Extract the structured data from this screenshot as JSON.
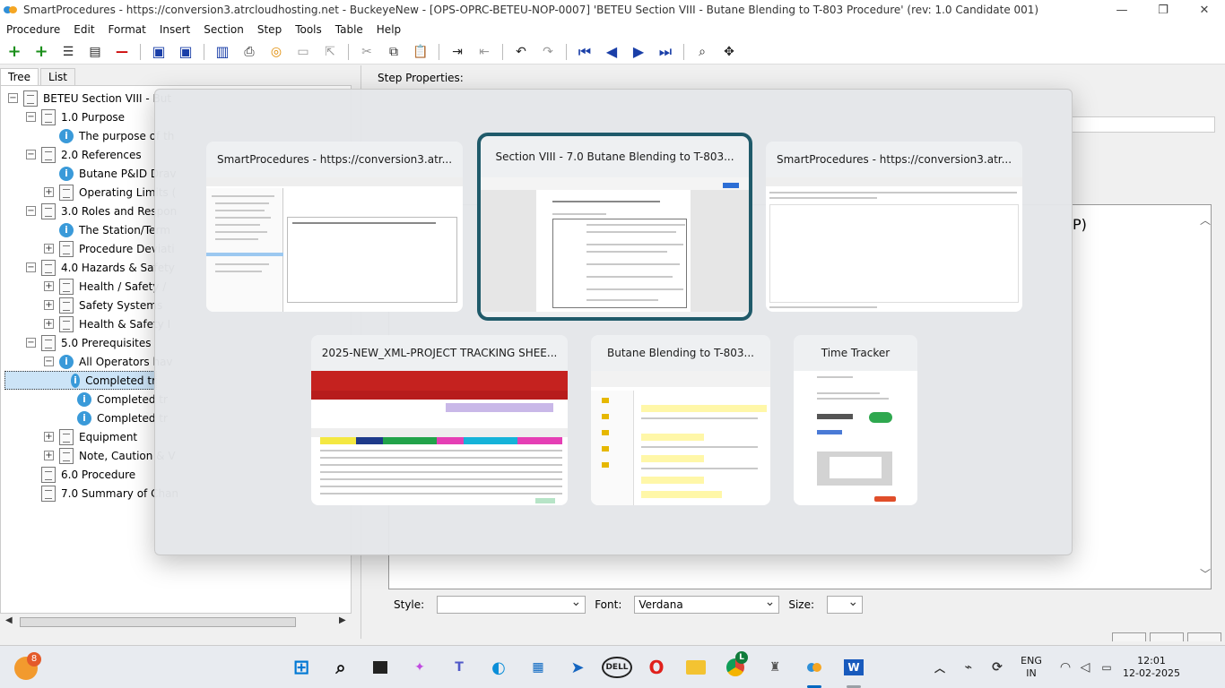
{
  "window": {
    "title": "SmartProcedures - https://conversion3.atrcloudhosting.net - BuckeyeNew - [OPS-OPRC-BETEU-NOP-0007] 'BETEU Section VIII - Butane Blending to T-803 Procedure' (rev: 1.0 Candidate 001)"
  },
  "menu": [
    "Procedure",
    "Edit",
    "Format",
    "Insert",
    "Section",
    "Step",
    "Tools",
    "Table",
    "Help"
  ],
  "left_tabs": [
    "Tree",
    "List"
  ],
  "tree": [
    {
      "label": "BETEU Section VIII - But",
      "type": "doc",
      "exp": "−"
    },
    {
      "label": "1.0 Purpose",
      "type": "doc",
      "exp": "−"
    },
    {
      "label": "The purpose of th",
      "type": "info"
    },
    {
      "label": "2.0 References",
      "type": "doc",
      "exp": "−"
    },
    {
      "label": "Butane P&ID Drav",
      "type": "info"
    },
    {
      "label": "Operating Limits (",
      "type": "doc",
      "exp": "+"
    },
    {
      "label": "3.0 Roles and Respon",
      "type": "doc",
      "exp": "−"
    },
    {
      "label": "The Station/Term",
      "type": "info"
    },
    {
      "label": "Procedure Deviati",
      "type": "doc",
      "exp": "+"
    },
    {
      "label": "4.0 Hazards & Safety",
      "type": "doc",
      "exp": "−"
    },
    {
      "label": "Health / Safety /",
      "type": "doc",
      "exp": "+"
    },
    {
      "label": "Safety Systems",
      "type": "doc",
      "exp": "+"
    },
    {
      "label": "Health & Safety I",
      "type": "doc",
      "exp": "+"
    },
    {
      "label": "5.0 Prerequisites",
      "type": "doc",
      "exp": "−"
    },
    {
      "label": "All Operators hav",
      "type": "info",
      "exp": "−"
    },
    {
      "label": "Completed tr",
      "type": "info",
      "selected": true
    },
    {
      "label": "Completed tr",
      "type": "info"
    },
    {
      "label": "Completed tr",
      "type": "info"
    },
    {
      "label": "Equipment",
      "type": "doc",
      "exp": "+"
    },
    {
      "label": "Note, Caution & V",
      "type": "doc",
      "exp": "+"
    },
    {
      "label": "6.0 Procedure",
      "type": "doc"
    },
    {
      "label": "7.0 Summary of Chan",
      "type": "doc"
    }
  ],
  "right_panel": {
    "step_properties": "Step Properties:",
    "editor_fragment": "P)",
    "style_label": "Style:",
    "font_label": "Font:",
    "font_value": "Verdana",
    "size_label": "Size:"
  },
  "switcher": {
    "cards": [
      {
        "title": "SmartProcedures - https://conversion3.atr..."
      },
      {
        "title": "Section VIII - 7.0 Butane Blending to T-803..."
      },
      {
        "title": "SmartProcedures - https://conversion3.atr..."
      },
      {
        "title": "2025-NEW_XML-PROJECT TRACKING SHEE..."
      },
      {
        "title": "Butane Blending to T-803..."
      },
      {
        "title": "Time Tracker"
      }
    ]
  },
  "taskbar": {
    "notification_count": "8",
    "chrome_badge": "L",
    "language_line1": "ENG",
    "language_line2": "IN",
    "time": "12:01",
    "date": "12-02-2025"
  },
  "colors": {
    "selection": "#cce4f7",
    "focus_ring": "#1f5a6a",
    "info_icon": "#3a9ad9",
    "taskbar": "#e8ebf0"
  }
}
